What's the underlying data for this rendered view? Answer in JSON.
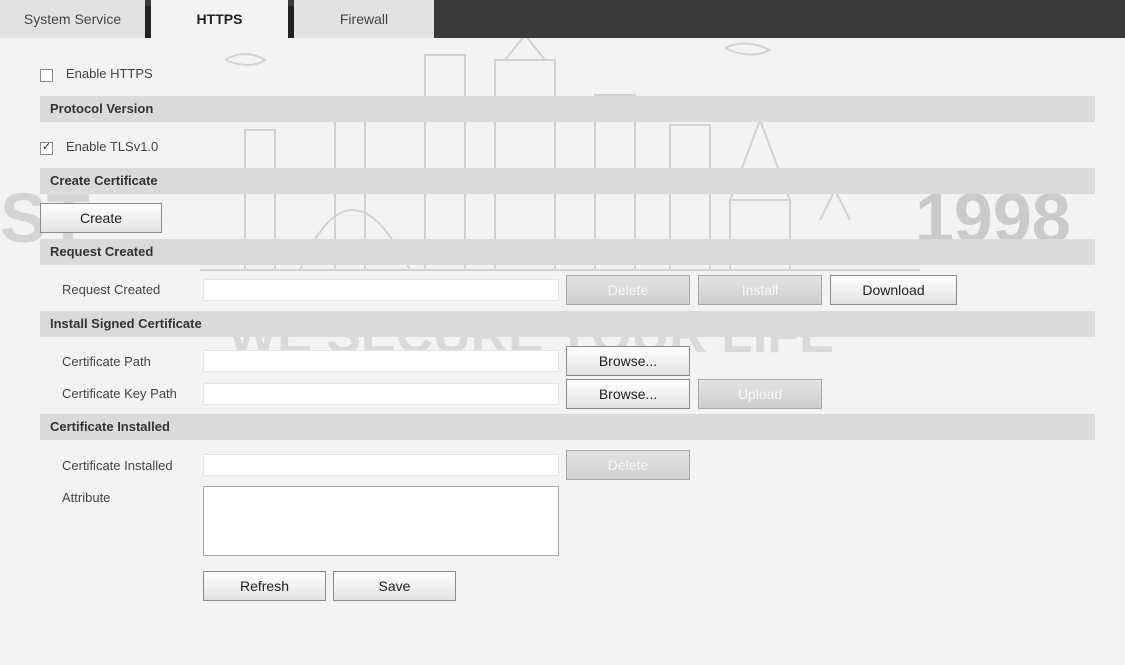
{
  "tabs": [
    {
      "label": "System Service"
    },
    {
      "label": "HTTPS"
    },
    {
      "label": "Firewall"
    }
  ],
  "watermark": {
    "year": "1998",
    "slogan": "WE SECURE YOUR LIFE"
  },
  "enable_https": {
    "label": "Enable HTTPS",
    "checked": false
  },
  "sections": {
    "protocol_version": "Protocol Version",
    "create_certificate": "Create Certificate",
    "request_created": "Request Created",
    "install_signed": "Install Signed Certificate",
    "certificate_installed": "Certificate Installed"
  },
  "enable_tls": {
    "label": "Enable TLSv1.0",
    "checked": true
  },
  "buttons": {
    "create": "Create",
    "delete_request": "Delete",
    "install": "Install",
    "download": "Download",
    "browse_cert": "Browse...",
    "browse_key": "Browse...",
    "upload": "Upload",
    "delete_installed": "Delete",
    "refresh": "Refresh",
    "save": "Save"
  },
  "fields": {
    "request_created": {
      "label": "Request Created",
      "value": ""
    },
    "certificate_path": {
      "label": "Certificate Path",
      "value": ""
    },
    "certificate_key_path": {
      "label": "Certificate Key Path",
      "value": ""
    },
    "certificate_installed": {
      "label": "Certificate Installed",
      "value": ""
    },
    "attribute": {
      "label": "Attribute",
      "value": ""
    }
  }
}
